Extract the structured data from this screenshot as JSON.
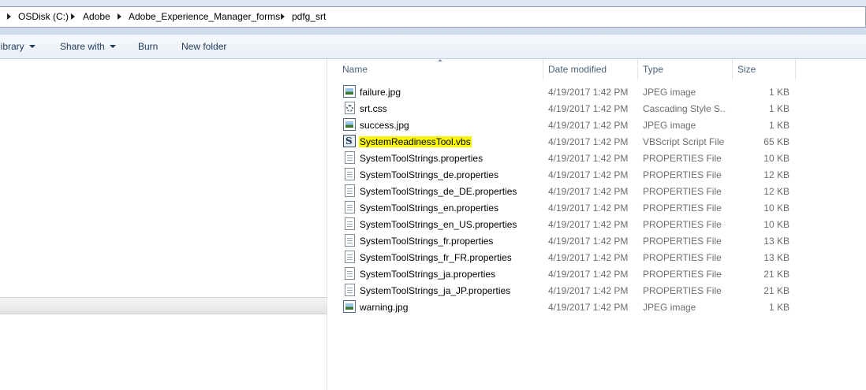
{
  "breadcrumb": {
    "items": [
      "OSDisk (C:)",
      "Adobe",
      "Adobe_Experience_Manager_forms",
      "pdfg_srt"
    ]
  },
  "toolbar": {
    "library_label": "library",
    "share_label": "Share with",
    "burn_label": "Burn",
    "new_folder_label": "New folder"
  },
  "columns": {
    "name": "Name",
    "date": "Date modified",
    "type": "Type",
    "size": "Size"
  },
  "files": [
    {
      "name": "failure.jpg",
      "date": "4/19/2017 1:42 PM",
      "type": "JPEG image",
      "size": "1 KB",
      "icon": "image-file-icon"
    },
    {
      "name": "srt.css",
      "date": "4/19/2017 1:42 PM",
      "type": "Cascading Style S...",
      "size": "1 KB",
      "icon": "css-file-icon"
    },
    {
      "name": "success.jpg",
      "date": "4/19/2017 1:42 PM",
      "type": "JPEG image",
      "size": "1 KB",
      "icon": "image-file-icon"
    },
    {
      "name": "SystemReadinessTool.vbs",
      "date": "4/19/2017 1:42 PM",
      "type": "VBScript Script File",
      "size": "65 KB",
      "icon": "vbscript-file-icon",
      "highlighted": true
    },
    {
      "name": "SystemToolStrings.properties",
      "date": "4/19/2017 1:42 PM",
      "type": "PROPERTIES File",
      "size": "10 KB",
      "icon": "properties-file-icon"
    },
    {
      "name": "SystemToolStrings_de.properties",
      "date": "4/19/2017 1:42 PM",
      "type": "PROPERTIES File",
      "size": "12 KB",
      "icon": "properties-file-icon"
    },
    {
      "name": "SystemToolStrings_de_DE.properties",
      "date": "4/19/2017 1:42 PM",
      "type": "PROPERTIES File",
      "size": "12 KB",
      "icon": "properties-file-icon"
    },
    {
      "name": "SystemToolStrings_en.properties",
      "date": "4/19/2017 1:42 PM",
      "type": "PROPERTIES File",
      "size": "10 KB",
      "icon": "properties-file-icon"
    },
    {
      "name": "SystemToolStrings_en_US.properties",
      "date": "4/19/2017 1:42 PM",
      "type": "PROPERTIES File",
      "size": "10 KB",
      "icon": "properties-file-icon"
    },
    {
      "name": "SystemToolStrings_fr.properties",
      "date": "4/19/2017 1:42 PM",
      "type": "PROPERTIES File",
      "size": "13 KB",
      "icon": "properties-file-icon"
    },
    {
      "name": "SystemToolStrings_fr_FR.properties",
      "date": "4/19/2017 1:42 PM",
      "type": "PROPERTIES File",
      "size": "13 KB",
      "icon": "properties-file-icon"
    },
    {
      "name": "SystemToolStrings_ja.properties",
      "date": "4/19/2017 1:42 PM",
      "type": "PROPERTIES File",
      "size": "21 KB",
      "icon": "properties-file-icon"
    },
    {
      "name": "SystemToolStrings_ja_JP.properties",
      "date": "4/19/2017 1:42 PM",
      "type": "PROPERTIES File",
      "size": "21 KB",
      "icon": "properties-file-icon"
    },
    {
      "name": "warning.jpg",
      "date": "4/19/2017 1:42 PM",
      "type": "JPEG image",
      "size": "1 KB",
      "icon": "image-file-icon"
    }
  ],
  "colors": {
    "highlight": "#f8f800",
    "header_text": "#4c607a",
    "secondary_text": "#6d6d6d"
  }
}
